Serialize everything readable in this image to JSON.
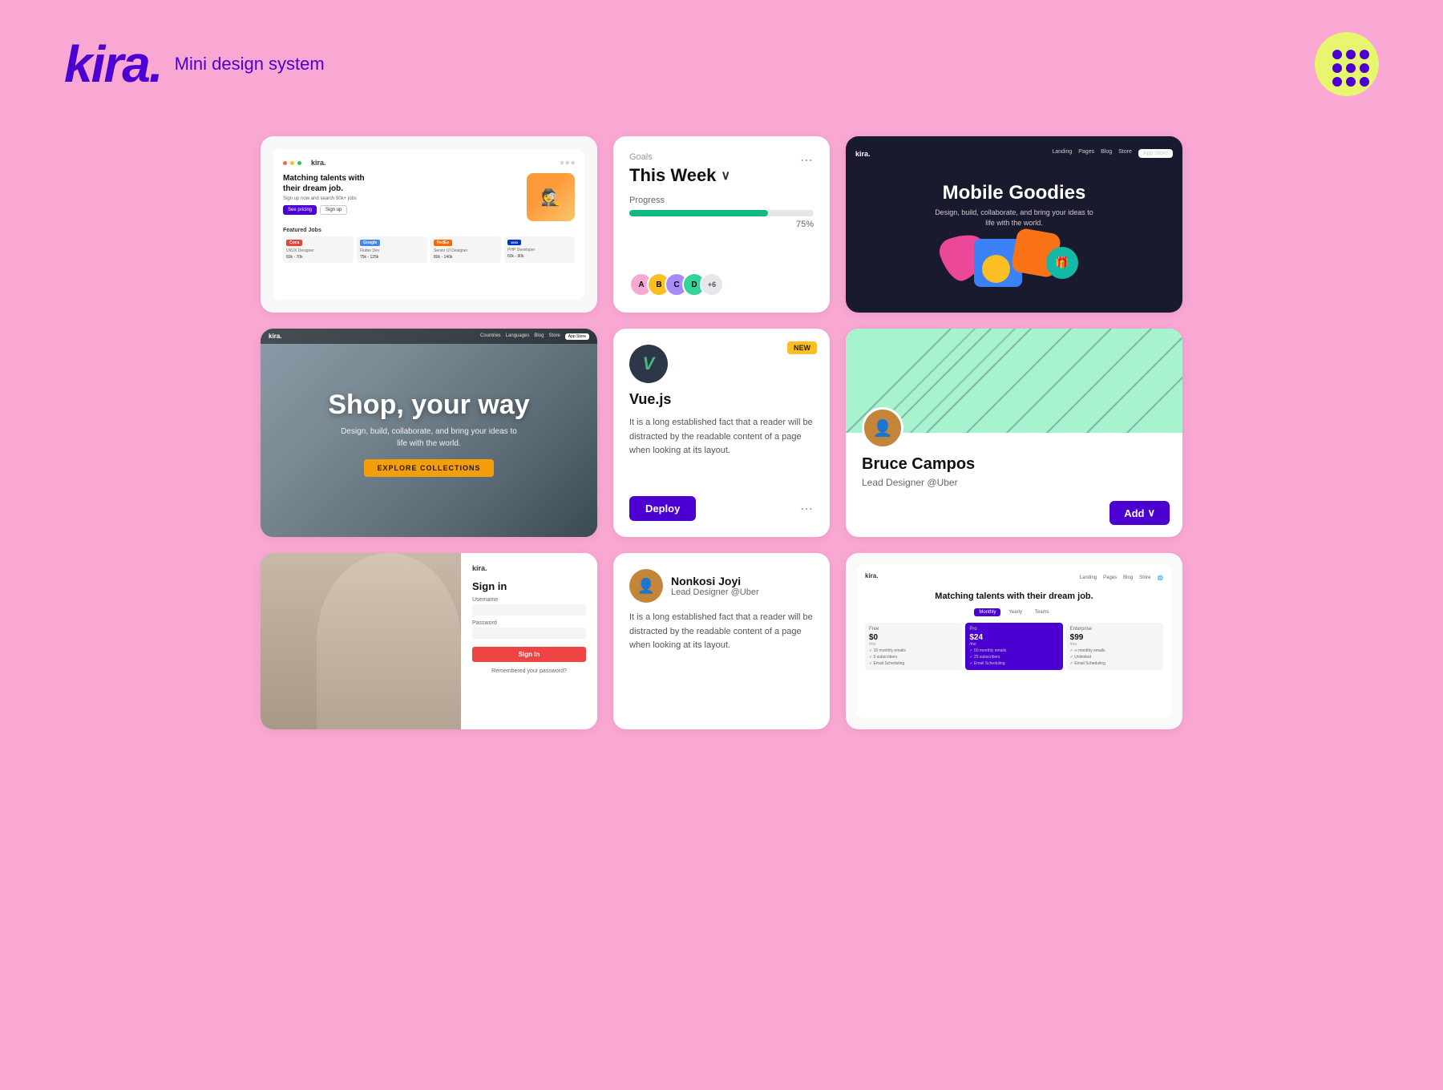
{
  "header": {
    "logo": "kira.",
    "subtitle": "Mini design system",
    "grid_btn_label": "grid"
  },
  "cards": {
    "job_site": {
      "brand": "kira.",
      "hero_title": "Matching talents with their dream job.",
      "hero_sub": "Sign up now and search 90k+ jobs",
      "btn_pricing": "See pricing",
      "btn_signup": "Sign up",
      "featured_label": "Featured Jobs",
      "jobs": [
        {
          "company": "Coca-Cola",
          "role": "UI/UX Designer",
          "salary": "60k - 70k"
        },
        {
          "company": "Google",
          "role": "Flutter Developer",
          "salary": "75k - 125k"
        },
        {
          "company": "FedEx",
          "role": "Senior UI Designer",
          "salary": "80k - 140k"
        },
        {
          "company": "1000",
          "role": "PHP Developer",
          "salary": "60k - 90k"
        }
      ]
    },
    "goals": {
      "label": "Goals",
      "week": "This Week",
      "progress_label": "Progress",
      "progress_pct": "75%",
      "progress_value": 75,
      "avatar_count": "+6"
    },
    "mobile_goodies": {
      "brand": "kira.",
      "title": "Mobile Goodies",
      "subtitle": "Design, build, collaborate, and bring your ideas to life with the world.",
      "nav": [
        "Landing",
        "Pages",
        "Blog",
        "Store"
      ]
    },
    "shop": {
      "brand": "kira.",
      "title": "Shop, your way",
      "subtitle": "Design, build, collaborate, and bring your ideas to life with the world.",
      "btn": "EXPLORE COLLECTIONS",
      "nav": [
        "Countries",
        "Languages",
        "Blog",
        "Store"
      ]
    },
    "vuejs": {
      "badge": "NEW",
      "name": "Vue.js",
      "desc": "It is a long established fact that a reader will be distracted by the readable content of a page when looking at its layout.",
      "deploy_btn": "Deploy",
      "more_btn": "..."
    },
    "bruce": {
      "name": "Bruce Campos",
      "role": "Lead Designer @Uber",
      "add_btn": "Add"
    },
    "signin": {
      "brand": "kira.",
      "title": "Sign in",
      "username_label": "Username",
      "password_label": "Password",
      "btn": "Sign In",
      "forgot": "Remembered your password?"
    },
    "nonkosi": {
      "name": "Nonkosi Joyi",
      "role": "Lead Designer @Uber",
      "desc": "It is a long established fact that a reader will be distracted by the readable content of a page when looking at its layout."
    },
    "pricing": {
      "brand": "kira.",
      "hero_title": "Matching talents with their dream job.",
      "toggle": [
        "Monthly",
        "Yearly",
        "Teams"
      ],
      "active_toggle": "Monthly",
      "plans": [
        {
          "name": "Free",
          "price": "$0",
          "period": "/mo",
          "highlight": false
        },
        {
          "name": "Pro",
          "price": "$24",
          "period": "/mo",
          "highlight": true
        },
        {
          "name": "Enterprise",
          "price": "$99",
          "period": "/mo",
          "highlight": false
        }
      ]
    }
  },
  "colors": {
    "bg_pink": "#f9a8d4",
    "purple": "#4b00d1",
    "lime": "#e8f56e",
    "green": "#10b981",
    "amber": "#fbbf24",
    "card_bg": "#ffffff"
  }
}
